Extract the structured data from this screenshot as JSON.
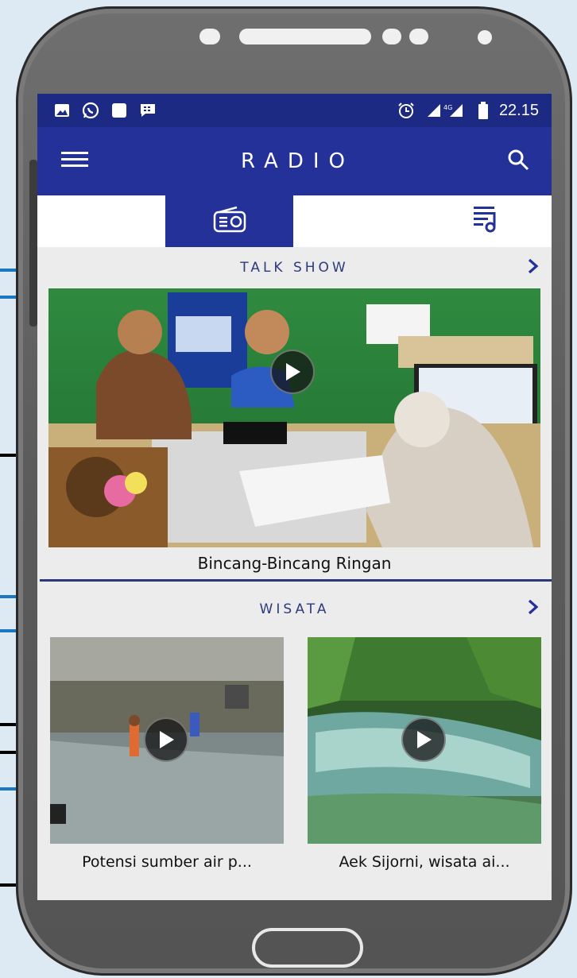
{
  "status_bar": {
    "time": "22.15",
    "network": "4G"
  },
  "app_bar": {
    "title": "RADIO",
    "menu_icon": "hamburger-menu-icon",
    "search_icon": "search-icon"
  },
  "tabs": [
    {
      "icon": "radio-icon",
      "active": true
    },
    {
      "icon": "playlist-music-icon",
      "active": false
    }
  ],
  "talk_show": {
    "title": "TALK SHOW",
    "item": {
      "caption": "Bincang-Bincang Ringan"
    }
  },
  "wisata": {
    "title": "WISATA",
    "items": [
      {
        "caption": "Potensi sumber air p..."
      },
      {
        "caption": "Aek Sijorni, wisata ai..."
      }
    ]
  },
  "colors": {
    "primary": "#233199",
    "status_bar": "#1d2a84",
    "pointer_blue": "#1a78c2",
    "pointer_black": "#000000"
  }
}
